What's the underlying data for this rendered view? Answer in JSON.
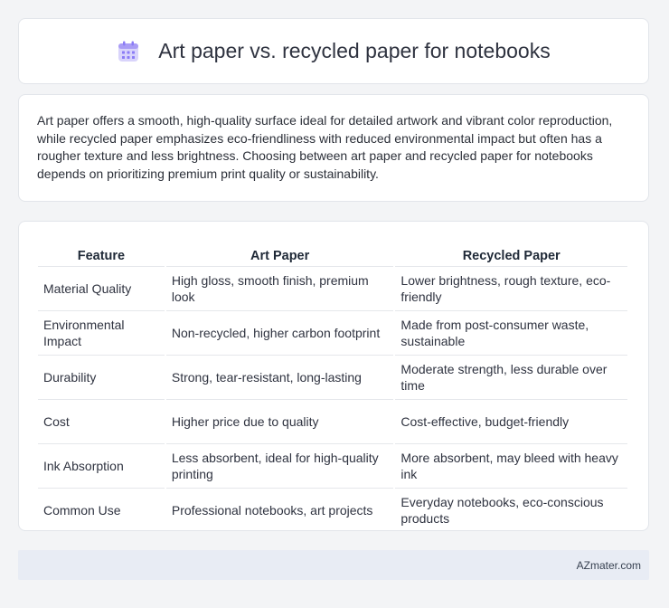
{
  "header": {
    "title": "Art paper vs. recycled paper for notebooks",
    "icon": "calendar-icon"
  },
  "summary": {
    "text": "Art paper offers a smooth, high-quality surface ideal for detailed artwork and vibrant color reproduction, while recycled paper emphasizes eco-friendliness with reduced environmental impact but often has a rougher texture and less brightness. Choosing between art paper and recycled paper for notebooks depends on prioritizing premium print quality or sustainability."
  },
  "table": {
    "headers": [
      "Feature",
      "Art Paper",
      "Recycled Paper"
    ],
    "rows": [
      [
        "Material Quality",
        "High gloss, smooth finish, premium look",
        "Lower brightness, rough texture, eco-friendly"
      ],
      [
        "Environmental Impact",
        "Non-recycled, higher carbon footprint",
        "Made from post-consumer waste, sustainable"
      ],
      [
        "Durability",
        "Strong, tear-resistant, long-lasting",
        "Moderate strength, less durable over time"
      ],
      [
        "Cost",
        "Higher price due to quality",
        "Cost-effective, budget-friendly"
      ],
      [
        "Ink Absorption",
        "Less absorbent, ideal for high-quality printing",
        "More absorbent, may bleed with heavy ink"
      ],
      [
        "Common Use",
        "Professional notebooks, art projects",
        "Everyday notebooks, eco-conscious products"
      ]
    ]
  },
  "footer": {
    "brand": "AZmater.com"
  },
  "colors": {
    "background": "#f3f4f6",
    "card": "#ffffff",
    "footer_bg": "#e8ecf4",
    "icon_accent": "#8b7cf6"
  }
}
